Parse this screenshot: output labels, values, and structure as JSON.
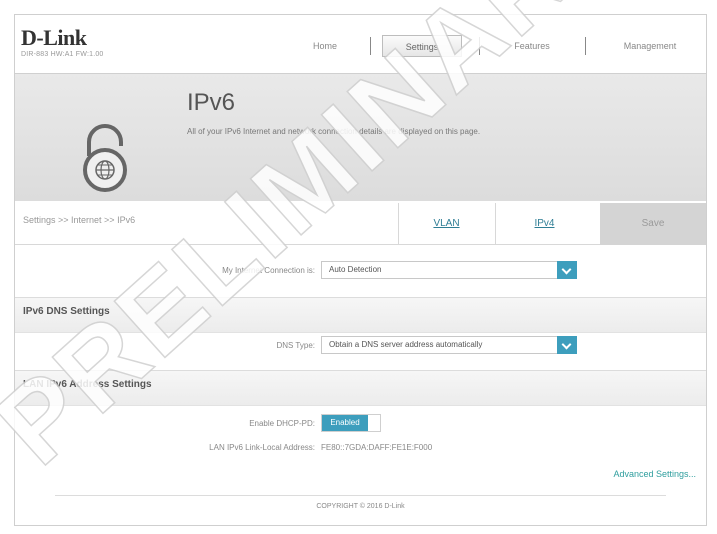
{
  "brand": {
    "logo": "D-Link",
    "model": "DIR-883 HW:A1 FW:1.00"
  },
  "nav": {
    "home": "Home",
    "settings": "Settings",
    "features": "Features",
    "management": "Management"
  },
  "banner": {
    "title": "IPv6",
    "description": "All of your IPv6 Internet and network connection details are displayed on this page."
  },
  "tabs": {
    "breadcrumb": "Settings >> Internet >> IPv6",
    "vlan": "VLAN",
    "ipv4": "IPv4",
    "save": "Save"
  },
  "connection": {
    "label": "My Internet Connection is:",
    "value": "Auto Detection"
  },
  "dns": {
    "section_title": "IPv6 DNS Settings",
    "label": "DNS Type:",
    "value": "Obtain a DNS server address automatically"
  },
  "lan": {
    "section_title": "LAN IPv6 Address Settings",
    "dhcp_label": "Enable DHCP-PD:",
    "dhcp_value": "Enabled",
    "link_local_label": "LAN IPv6 Link-Local Address:",
    "link_local_value": "FE80::7GDA:DAFF:FE1E:F000"
  },
  "advanced": "Advanced Settings...",
  "footer": "COPYRIGHT © 2016 D-Link",
  "watermark": "PRELIMINARY VERSION",
  "colors": {
    "accent": "#3d9ebd",
    "link": "#2f7e95"
  }
}
